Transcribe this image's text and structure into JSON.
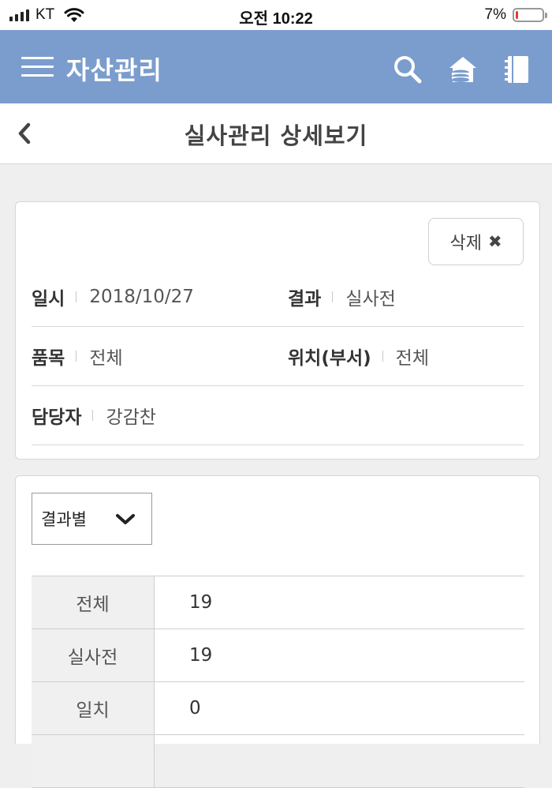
{
  "status_bar": {
    "carrier": "KT",
    "time": "오전 10:22",
    "battery_percent_text": "7%",
    "battery_level": 0.07,
    "battery_color": "#e53935"
  },
  "app_bar": {
    "title": "자산관리",
    "background": "#7b9dcd",
    "icons": [
      "menu-icon",
      "search-icon",
      "home-coins-icon",
      "notebook-icon"
    ]
  },
  "sub_header": {
    "title": "실사관리 상세보기",
    "back_icon": "chevron-left-icon"
  },
  "info": {
    "delete_label": "삭제",
    "delete_icon": "close-icon",
    "rows": [
      [
        {
          "label": "일시",
          "value": "2018/10/27"
        },
        {
          "label": "결과",
          "value": "실사전"
        }
      ],
      [
        {
          "label": "품목",
          "value": "전체"
        },
        {
          "label": "위치(부서)",
          "value": "전체"
        }
      ],
      [
        {
          "label": "담당자",
          "value": "강감찬"
        }
      ]
    ]
  },
  "result": {
    "filter_selected": "결과별",
    "filter_icon": "chevron-down-icon",
    "rows": [
      {
        "label": "전체",
        "value": "19"
      },
      {
        "label": "실사전",
        "value": "19"
      },
      {
        "label": "일치",
        "value": "0"
      }
    ]
  }
}
